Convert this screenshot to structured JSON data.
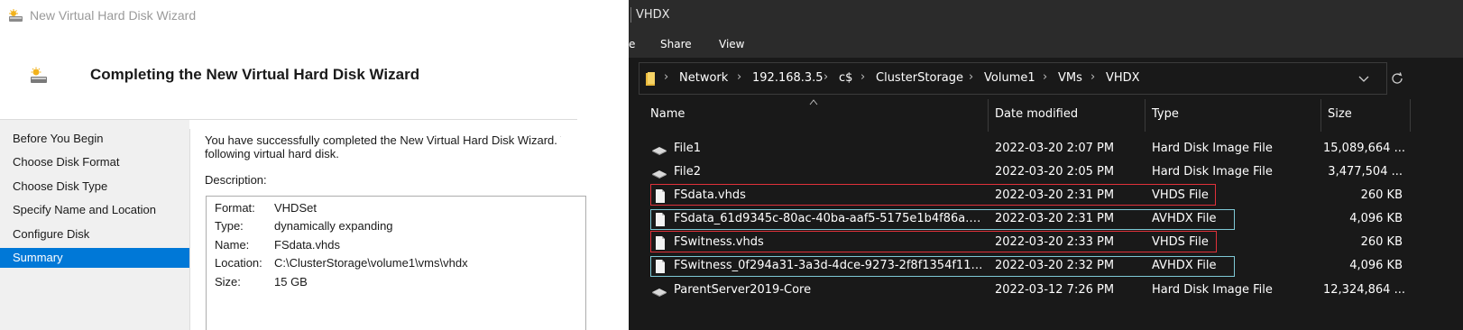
{
  "wizard": {
    "window_title": "New Virtual Hard Disk Wizard",
    "heading": "Completing the New Virtual Hard Disk Wizard",
    "nav": [
      {
        "label": "Before You Begin",
        "active": false
      },
      {
        "label": "Choose Disk Format",
        "active": false
      },
      {
        "label": "Choose Disk Type",
        "active": false
      },
      {
        "label": "Specify Name and Location",
        "active": false
      },
      {
        "label": "Configure Disk",
        "active": false
      },
      {
        "label": "Summary",
        "active": true
      }
    ],
    "message_line1": "You have successfully completed the New Virtual Hard Disk Wizard. Y",
    "message_line2": "following virtual hard disk.",
    "description_label": "Description:",
    "description": [
      {
        "key": "Format:",
        "value": "VHDSet"
      },
      {
        "key": "Type:",
        "value": "dynamically expanding"
      },
      {
        "key": "Name:",
        "value": "FSdata.vhds"
      },
      {
        "key": "Location:",
        "value": "C:\\ClusterStorage\\volume1\\vms\\vhdx"
      },
      {
        "key": "Size:",
        "value": "15 GB"
      }
    ],
    "icon": "disk-wizard-icon"
  },
  "explorer": {
    "window_title": "VHDX",
    "ribbon_prev": "e",
    "ribbon_tabs": [
      "Share",
      "View"
    ],
    "breadcrumb": [
      "Network",
      "192.168.3.5",
      "c$",
      "ClusterStorage",
      "Volume1",
      "VMs",
      "VHDX"
    ],
    "columns": {
      "name": "Name",
      "date": "Date modified",
      "type": "Type",
      "size": "Size"
    },
    "files": [
      {
        "name": "File1",
        "date": "2022-03-20 2:07 PM",
        "type": "Hard Disk Image File",
        "size": "15,089,664 ...",
        "icon": "disk-image-icon",
        "highlight": "none"
      },
      {
        "name": "File2",
        "date": "2022-03-20 2:05 PM",
        "type": "Hard Disk Image File",
        "size": "3,477,504 ...",
        "icon": "disk-image-icon",
        "highlight": "none"
      },
      {
        "name": "FSdata.vhds",
        "date": "2022-03-20 2:31 PM",
        "type": "VHDS File",
        "size": "260 KB",
        "icon": "file-icon",
        "highlight": "red"
      },
      {
        "name": "FSdata_61d9345c-80ac-40ba-aaf5-5175e1b4f86a.a...",
        "date": "2022-03-20 2:31 PM",
        "type": "AVHDX File",
        "size": "4,096 KB",
        "icon": "file-icon",
        "highlight": "cyan"
      },
      {
        "name": "FSwitness.vhds",
        "date": "2022-03-20 2:33 PM",
        "type": "VHDS File",
        "size": "260 KB",
        "icon": "file-icon",
        "highlight": "red"
      },
      {
        "name": "FSwitness_0f294a31-3a3d-4dce-9273-2f8f1354f11a....",
        "date": "2022-03-20 2:32 PM",
        "type": "AVHDX File",
        "size": "4,096 KB",
        "icon": "file-icon",
        "highlight": "cyan"
      },
      {
        "name": "ParentServer2019-Core",
        "date": "2022-03-12 7:26 PM",
        "type": "Hard Disk Image File",
        "size": "12,324,864 ...",
        "icon": "disk-image-icon",
        "highlight": "none"
      }
    ],
    "colors": {
      "background": "#191919",
      "selection_red": "#e0313a",
      "selection_cyan": "#7fc9d6",
      "accent": "#0078d7"
    }
  }
}
